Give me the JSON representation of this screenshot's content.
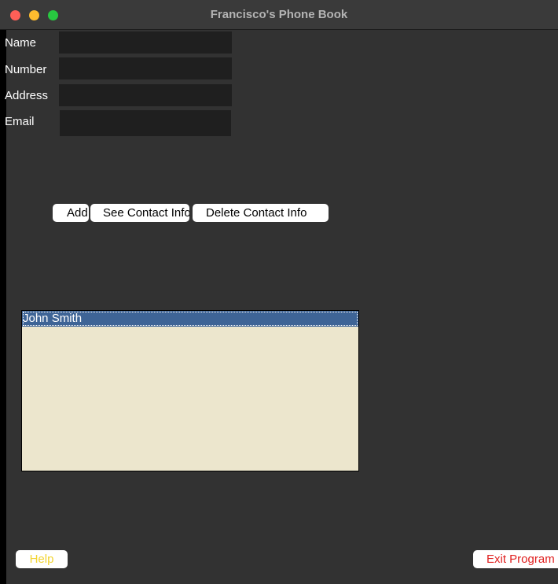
{
  "window": {
    "title": "Francisco's Phone Book"
  },
  "form": {
    "fields": [
      {
        "label": "Name",
        "value": ""
      },
      {
        "label": "Number",
        "value": ""
      },
      {
        "label": "Address",
        "value": ""
      },
      {
        "label": "Email",
        "value": ""
      }
    ]
  },
  "actions": {
    "add_label": "Add",
    "see_label": "See Contact Info",
    "delete_label": "Delete Contact Info"
  },
  "contacts": {
    "items": [
      "John Smith"
    ],
    "selected": "John Smith"
  },
  "footer": {
    "help_label": "Help",
    "exit_label": "Exit Program"
  },
  "colors": {
    "window_bg": "#323232",
    "input_bg": "#1f1f1f",
    "list_bg": "#ece6cd",
    "selection": "#3e6496",
    "help_text": "#f2d431",
    "exit_text": "#e0201f"
  }
}
